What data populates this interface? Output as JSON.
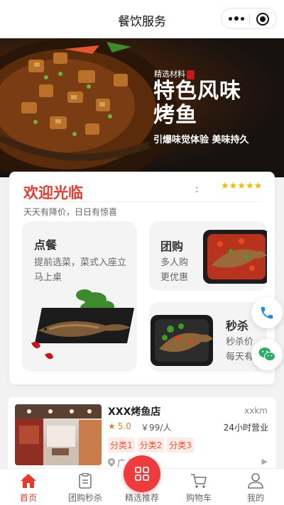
{
  "app": {
    "title": "餐饮服务"
  },
  "banner": {
    "tag": "精选材料",
    "headline_line1": "特色风味",
    "headline_line2": "烤鱼",
    "subtitle": "引爆味觉体验 美味持久"
  },
  "welcome": {
    "title": "欢迎光临",
    "colon": ":",
    "stars": "★★★★★",
    "rating_stars": 5,
    "subtitle": "天天有降价，日日有惊喜"
  },
  "tiles": {
    "order": {
      "title": "点餐",
      "desc": "提前选菜，菜式入座立马上桌"
    },
    "group": {
      "title": "团购",
      "desc_line1": "多人购",
      "desc_line2": "更优惠"
    },
    "seckill": {
      "title": "秒杀",
      "desc_line1": "秒杀价",
      "desc_line2": "每天有"
    }
  },
  "store": {
    "name": "XXX烤鱼店",
    "distance": "xxkm",
    "rating": "5.0",
    "price": "￥99/人",
    "hours": "24小时营业",
    "tags": [
      "分类1",
      "分类2",
      "分类3"
    ],
    "address": "广        湾区"
  },
  "tabbar": {
    "items": [
      {
        "label": "首页"
      },
      {
        "label": "团购秒杀"
      },
      {
        "label": "精选推荐"
      },
      {
        "label": "购物车"
      },
      {
        "label": "我的"
      }
    ]
  },
  "colors": {
    "accent": "#e8392d",
    "star": "#f7b500",
    "tag_bg": "#fdebe6",
    "phone": "#1e88e5",
    "wechat": "#2aae67"
  }
}
